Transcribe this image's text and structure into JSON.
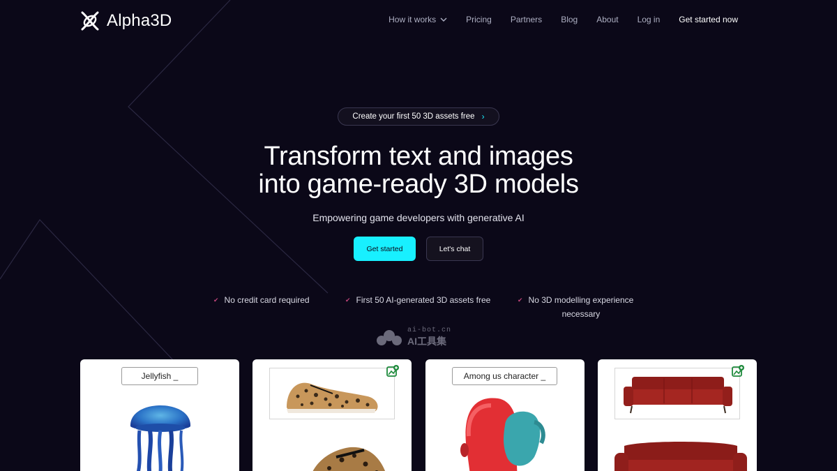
{
  "brand": {
    "name": "Alpha3D",
    "accent": "#18f0ff",
    "background": "#0b0818"
  },
  "nav": {
    "items": [
      {
        "label": "How it works",
        "icon": "chevron-down-icon"
      },
      {
        "label": "Pricing"
      },
      {
        "label": "Partners"
      },
      {
        "label": "Blog"
      },
      {
        "label": "About"
      },
      {
        "label": "Log in"
      },
      {
        "label": "Get started now"
      }
    ]
  },
  "hero": {
    "pill": "Create your first 50 3D assets free",
    "pill_arrow": "›",
    "title_line1": "Transform text and images",
    "title_line2": "into game-ready 3D models",
    "subtitle": "Empowering game developers with generative AI",
    "primary_button": "Get started",
    "secondary_button": "Let's chat"
  },
  "features": [
    {
      "check": "✔",
      "text": "No credit card required"
    },
    {
      "check": "✔",
      "text": "First 50 AI-generated 3D assets free"
    },
    {
      "check": "✔",
      "text_line1": "No 3D modelling experience",
      "text_line2": "necessary"
    }
  ],
  "watermark": {
    "top": "ai-bot.cn",
    "bottom": "AI工具集"
  },
  "cards": [
    {
      "type": "text-prompt",
      "prompt": "Jellyfish _",
      "subject": "jellyfish"
    },
    {
      "type": "image-prompt",
      "icon": "add-image-icon",
      "subject": "leopard sneaker"
    },
    {
      "type": "text-prompt",
      "prompt": "Among us character _",
      "subject": "among us character"
    },
    {
      "type": "image-prompt",
      "icon": "add-image-icon",
      "subject": "red sofa"
    }
  ]
}
